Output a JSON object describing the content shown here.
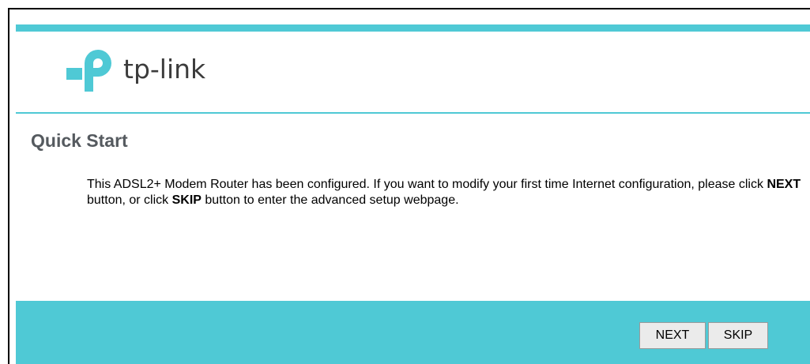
{
  "header": {
    "brand": "tp-link",
    "accent_color": "#4fc9d5"
  },
  "page": {
    "title": "Quick Start"
  },
  "message": {
    "part1": "This ADSL2+ Modem Router has been configured. If you want to modify your first time Internet configuration, please click ",
    "next_word": "NEXT",
    "part2": " button, or click ",
    "skip_word": "SKIP",
    "part3": " button to enter the advanced setup webpage."
  },
  "footer": {
    "next_label": "NEXT",
    "skip_label": "SKIP"
  }
}
